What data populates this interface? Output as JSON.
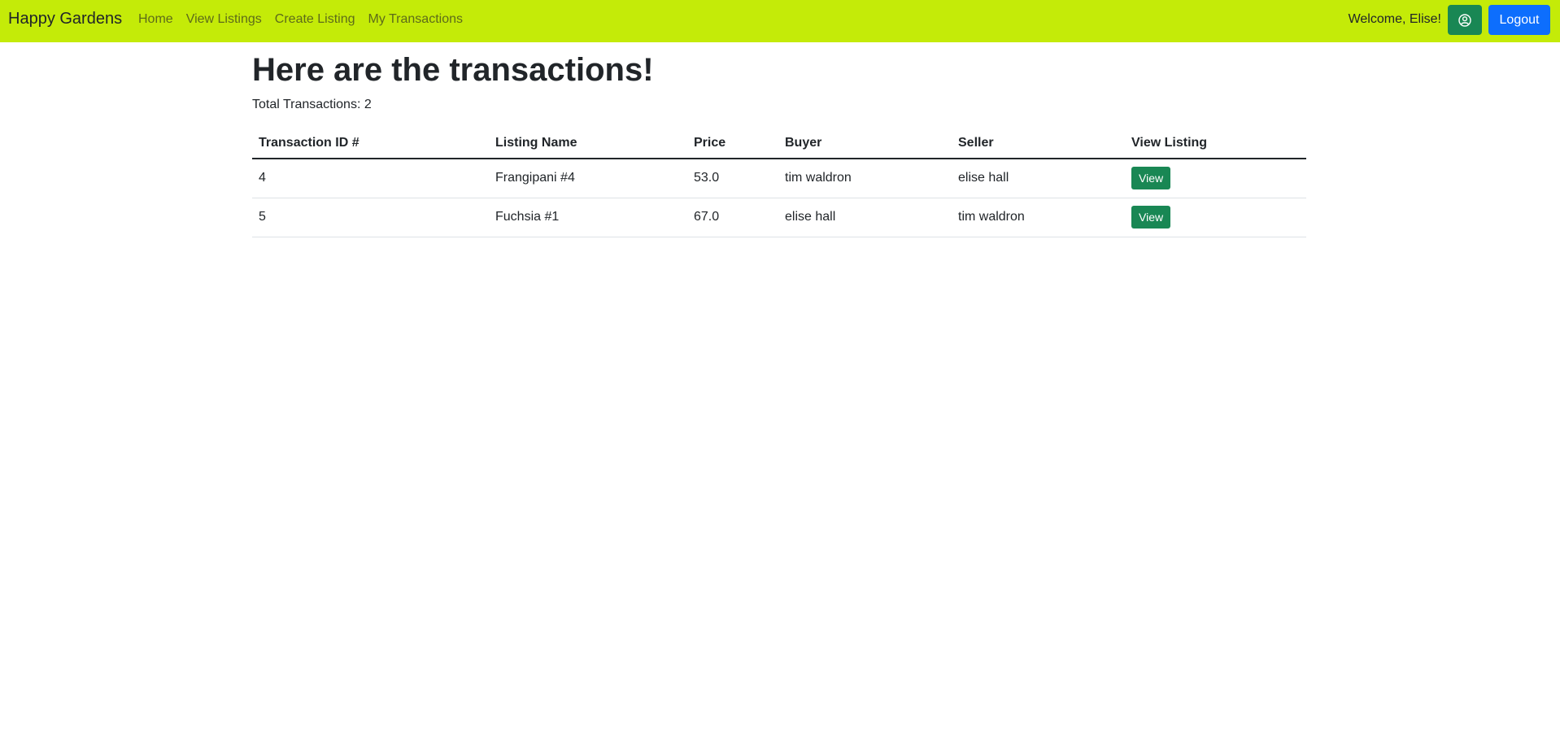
{
  "navbar": {
    "brand": "Happy Gardens",
    "links": [
      "Home",
      "View Listings",
      "Create Listing",
      "My Transactions"
    ],
    "welcome": "Welcome, Elise!",
    "profile_icon": "user-circle-icon",
    "logout_label": "Logout",
    "background": "#c4eb08"
  },
  "main": {
    "title": "Here are the transactions!",
    "total": "Total Transactions: 2"
  },
  "table": {
    "headers": [
      "Transaction ID #",
      "Listing Name",
      "Price",
      "Buyer",
      "Seller",
      "View Listing"
    ],
    "rows": [
      {
        "id": "4",
        "listing": "Frangipani #4",
        "price": "53.0",
        "buyer": "tim waldron",
        "seller": "elise hall",
        "action": "View"
      },
      {
        "id": "5",
        "listing": "Fuchsia #1",
        "price": "67.0",
        "buyer": "elise hall",
        "seller": "tim waldron",
        "action": "View"
      }
    ]
  },
  "colors": {
    "view_button": "#198754",
    "logout_button": "#0d6efd"
  }
}
